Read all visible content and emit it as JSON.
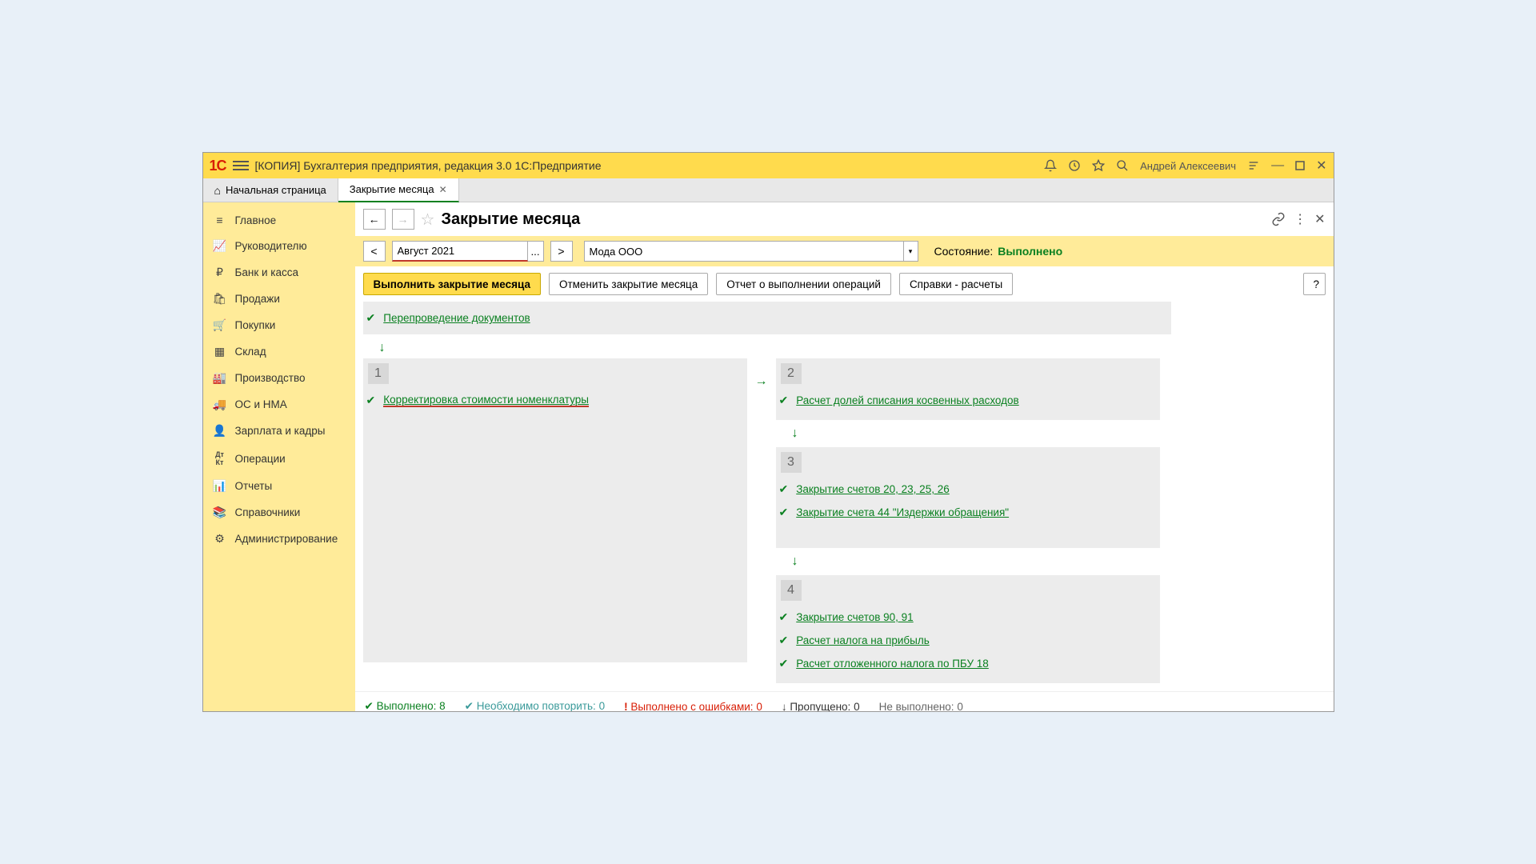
{
  "titlebar": {
    "app_title": "[КОПИЯ] Бухгалтерия предприятия, редакция 3.0 1С:Предприятие",
    "username": "Андрей Алексеевич"
  },
  "tabs": {
    "home": "Начальная страница",
    "active": "Закрытие месяца"
  },
  "sidebar": {
    "items": [
      {
        "icon": "menu",
        "label": "Главное"
      },
      {
        "icon": "chart",
        "label": "Руководителю"
      },
      {
        "icon": "ruble",
        "label": "Банк и касса"
      },
      {
        "icon": "bag",
        "label": "Продажи"
      },
      {
        "icon": "cart",
        "label": "Покупки"
      },
      {
        "icon": "boxes",
        "label": "Склад"
      },
      {
        "icon": "factory",
        "label": "Производство"
      },
      {
        "icon": "truck",
        "label": "ОС и НМА"
      },
      {
        "icon": "person",
        "label": "Зарплата и кадры"
      },
      {
        "icon": "dtkt",
        "label": "Операции"
      },
      {
        "icon": "bars",
        "label": "Отчеты"
      },
      {
        "icon": "book",
        "label": "Справочники"
      },
      {
        "icon": "gear",
        "label": "Администрирование"
      }
    ]
  },
  "page": {
    "title": "Закрытие месяца",
    "period": "Август 2021",
    "organization": "Мода ООО",
    "state_label": "Состояние:",
    "state_value": "Выполнено"
  },
  "actions": {
    "execute": "Выполнить закрытие месяца",
    "cancel": "Отменить закрытие месяца",
    "report": "Отчет о выполнении операций",
    "refs": "Справки - расчеты",
    "help": "?"
  },
  "ops": {
    "repost": "Перепроведение документов",
    "block1_num": "1",
    "block1_op1": "Корректировка стоимости номенклатуры",
    "block2_num": "2",
    "block2_op1": "Расчет долей списания косвенных расходов",
    "block3_num": "3",
    "block3_op1": "Закрытие счетов 20, 23, 25, 26",
    "block3_op2": "Закрытие счета 44 \"Издержки обращения\"",
    "block4_num": "4",
    "block4_op1": "Закрытие счетов 90, 91",
    "block4_op2": "Расчет налога на прибыль",
    "block4_op3": "Расчет отложенного налога по ПБУ 18"
  },
  "status": {
    "done_label": "Выполнено:",
    "done_count": "8",
    "repeat_label": "Необходимо повторить:",
    "repeat_count": "0",
    "errors_label": "Выполнено с ошибками:",
    "errors_count": "0",
    "skipped_label": "Пропущено:",
    "skipped_count": "0",
    "notdone_label": "Не выполнено:",
    "notdone_count": "0"
  }
}
